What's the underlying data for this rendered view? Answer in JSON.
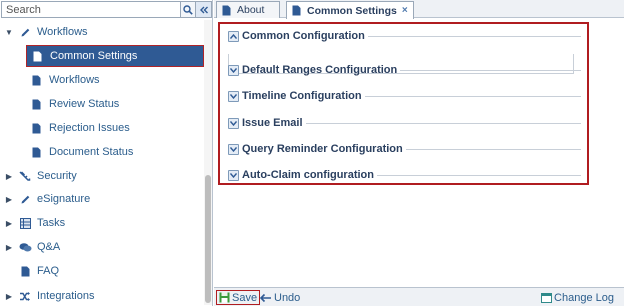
{
  "search": {
    "placeholder": "Search"
  },
  "sidebar": {
    "items": [
      {
        "label": "Workflows",
        "icon": "pencil-icon",
        "expanded": true
      },
      {
        "label": "Common Settings",
        "icon": "document-icon",
        "selected": true
      },
      {
        "label": "Workflows",
        "icon": "document-icon"
      },
      {
        "label": "Review Status",
        "icon": "document-icon"
      },
      {
        "label": "Rejection Issues",
        "icon": "document-icon"
      },
      {
        "label": "Document Status",
        "icon": "document-icon"
      },
      {
        "label": "Security",
        "icon": "key-icon"
      },
      {
        "label": "eSignature",
        "icon": "pencil-icon"
      },
      {
        "label": "Tasks",
        "icon": "list-icon"
      },
      {
        "label": "Q&A",
        "icon": "chat-icon"
      },
      {
        "label": "FAQ",
        "icon": "document-icon"
      },
      {
        "label": "Integrations",
        "icon": "shuffle-icon"
      }
    ]
  },
  "tabs": [
    {
      "label": "About",
      "icon": "document-icon"
    },
    {
      "label": "Common Settings",
      "icon": "document-icon",
      "active": true,
      "close": "×"
    }
  ],
  "main": {
    "sections": [
      {
        "title": "Common Configuration",
        "state": "expanded"
      },
      {
        "title": "Default Ranges Configuration",
        "state": "collapsed"
      },
      {
        "title": "Timeline Configuration",
        "state": "collapsed"
      },
      {
        "title": "Issue Email",
        "state": "collapsed"
      },
      {
        "title": "Query Reminder Configuration",
        "state": "collapsed"
      },
      {
        "title": "Auto-Claim configuration",
        "state": "collapsed"
      }
    ]
  },
  "toolbar": {
    "save_label": "Save",
    "undo_label": "Undo",
    "changelog_label": "Change Log"
  },
  "colors": {
    "accent_blue": "#2f5a94",
    "highlight_red": "#b01c20",
    "link_blue": "#2b5d8c"
  }
}
